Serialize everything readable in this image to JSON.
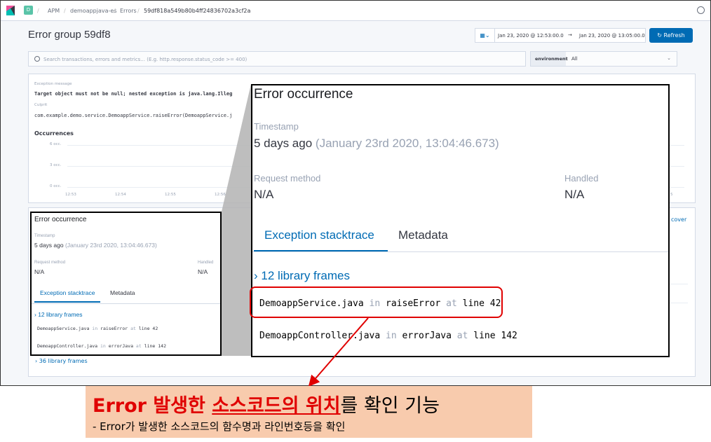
{
  "topbar": {
    "space_letter": "D",
    "breadcrumbs": [
      "APM",
      "demoappjava-es",
      "Errors",
      "59df818a549b80b4ff24836702a3cf2a"
    ]
  },
  "header": {
    "title": "Error group 59df8",
    "date_start": "Jan 23, 2020 @ 12:53:00.0",
    "date_arrow": "→",
    "date_end": "Jan 23, 2020 @ 13:05:00.0",
    "refresh_label": "Refresh"
  },
  "search": {
    "placeholder": "Search transactions, errors and metrics... (E.g. http.response.status_code >= 400)"
  },
  "environment": {
    "label": "environment",
    "value": "All"
  },
  "summary": {
    "exception_label": "Exception message",
    "exception_message": "Target object must not be null; nested exception is java.lang.Illeg",
    "culprit_label": "Culprit",
    "culprit": "com.example.demo.service.DemoappService.raiseError(DemoappService.j",
    "occurrences_title": "Occurrences",
    "y_ticks": [
      "6 occ.",
      "3 occ.",
      "0 occ."
    ],
    "x_ticks": [
      "12:53",
      "12:54",
      "12:55",
      "12:56"
    ],
    "x_tick_last": "5"
  },
  "occurrence": {
    "title": "Error occurrence",
    "timestamp_label": "Timestamp",
    "timestamp_relative": "5 days ago",
    "timestamp_absolute": "(January 23rd 2020, 13:04:46.673)",
    "request_method_label": "Request method",
    "request_method": "N/A",
    "handled_label": "Handled",
    "handled": "N/A",
    "tabs": [
      "Exception stacktrace",
      "Metadata"
    ],
    "library_frames": "12 library frames",
    "frames": [
      {
        "file": "DemoappService.java",
        "in": "in",
        "method": "raiseError",
        "at": "at",
        "line": "line 42"
      },
      {
        "file": "DemoappController.java",
        "in": "in",
        "method": "errorJava",
        "at": "at",
        "line": "line 142"
      }
    ],
    "library_frames_2": "36 library frames",
    "discover_fragment": "cover"
  },
  "callout": {
    "part1": "Error 발생한 ",
    "part2": "소스코드의 위치",
    "part3": "를 확인 기능",
    "subtitle": "- Error가 발생한 소스코드의 함수명과 라인번호등을 확인"
  },
  "colors": {
    "accent": "#006bb4",
    "highlight_red": "#e00000",
    "callout_bg": "#f8cbad"
  }
}
